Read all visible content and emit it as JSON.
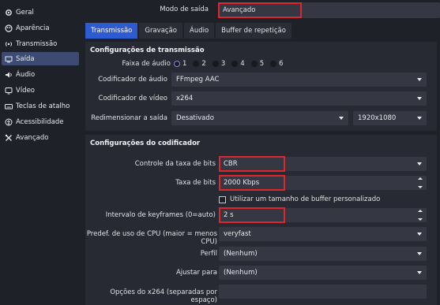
{
  "sidebar": {
    "items": [
      {
        "label": "Geral",
        "icon": "gear-icon"
      },
      {
        "label": "Aparência",
        "icon": "paint-icon"
      },
      {
        "label": "Transmissão",
        "icon": "broadcast-icon"
      },
      {
        "label": "Saída",
        "icon": "output-icon"
      },
      {
        "label": "Áudio",
        "icon": "speaker-icon"
      },
      {
        "label": "Vídeo",
        "icon": "monitor-icon"
      },
      {
        "label": "Teclas de atalho",
        "icon": "keyboard-icon"
      },
      {
        "label": "Acessibilidade",
        "icon": "accessibility-icon"
      },
      {
        "label": "Avançado",
        "icon": "tools-icon"
      }
    ],
    "active": "Saída"
  },
  "output_mode": {
    "label": "Modo de saída",
    "value": "Avançado"
  },
  "tabs": [
    "Transmissão",
    "Gravação",
    "Áudio",
    "Buffer de repetição"
  ],
  "active_tab": "Transmissão",
  "stream_settings": {
    "title": "Configurações de transmissão",
    "audio_track": {
      "label": "Faixa de áudio",
      "options": [
        "1",
        "2",
        "3",
        "4",
        "5",
        "6"
      ],
      "selected": "1"
    },
    "audio_encoder": {
      "label": "Codificador de áudio",
      "value": "FFmpeg AAC"
    },
    "video_encoder": {
      "label": "Codificador de vídeo",
      "value": "x264"
    },
    "rescale": {
      "label": "Redimensionar a saída",
      "value": "Desativado",
      "resolution": "1920x1080"
    }
  },
  "encoder_settings": {
    "title": "Configurações do codificador",
    "rate_control": {
      "label": "Controle da taxa de bits",
      "value": "CBR"
    },
    "bitrate": {
      "label": "Taxa de bits",
      "value": "2000 Kbps"
    },
    "custom_buffer": {
      "label": "Utilizar um tamanho de buffer personalizado",
      "checked": false
    },
    "keyframe": {
      "label": "Intervalo de keyframes (0=auto)",
      "value": "2 s"
    },
    "cpu_preset": {
      "label": "Predef. de uso de CPU (maior = menos CPU)",
      "value": "veryfast"
    },
    "profile": {
      "label": "Perfil",
      "value": "(Nenhum)"
    },
    "tune": {
      "label": "Ajustar para",
      "value": "(Nenhum)"
    },
    "x264_options": {
      "label": "Opções do x264 (separadas por espaço)",
      "value": ""
    }
  },
  "colors": {
    "accent": "#2f5bd2",
    "highlight": "#e0262c",
    "sidebar_active": "#3d4b73"
  }
}
